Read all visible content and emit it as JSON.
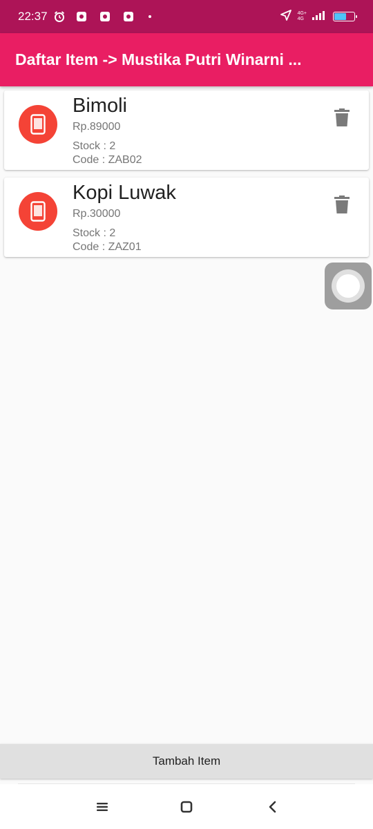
{
  "status_bar": {
    "time": "22:37",
    "network_label_top": "4G+",
    "network_label_bottom": "4G"
  },
  "app_bar": {
    "title": "Daftar Item -> Mustika Putri Winarni ..."
  },
  "items": [
    {
      "name": "Bimoli",
      "price": "Rp.89000",
      "stock": "Stock : 2",
      "code": "Code : ZAB02"
    },
    {
      "name": "Kopi Luwak",
      "price": "Rp.30000",
      "stock": "Stock : 2",
      "code": "Code : ZAZ01"
    }
  ],
  "add_button": {
    "label": "Tambah Item"
  },
  "icons": {
    "item_avatar": "phone-icon",
    "delete": "trash-icon",
    "nav_menu": "menu-icon",
    "nav_home": "home-icon",
    "nav_back": "back-icon"
  },
  "colors": {
    "status_bar": "#ad1457",
    "app_bar": "#e91e63",
    "avatar": "#f44336",
    "delete_icon": "#7a7a7a"
  }
}
